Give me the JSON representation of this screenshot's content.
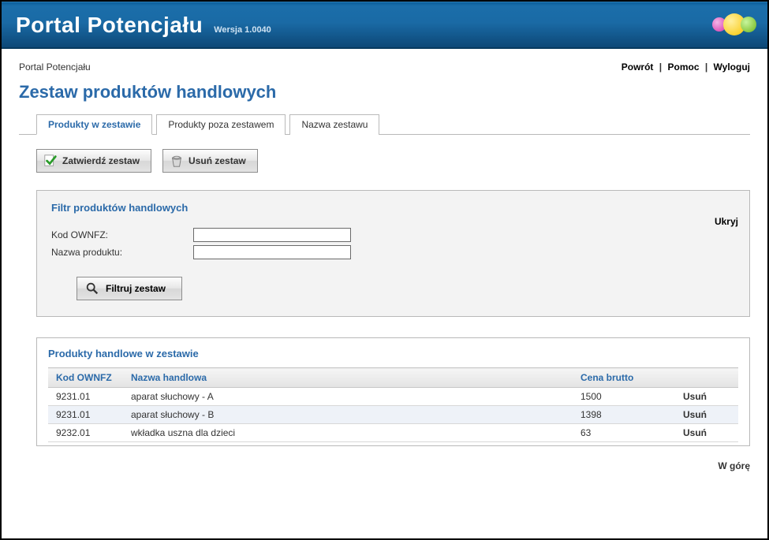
{
  "header": {
    "title": "Portal Potencjału",
    "version": "Wersja 1.0040"
  },
  "topbar": {
    "breadcrumb": "Portal Potencjału",
    "links": {
      "back": "Powrót",
      "help": "Pomoc",
      "logout": "Wyloguj"
    }
  },
  "page_title": "Zestaw produktów handlowych",
  "tabs": [
    {
      "label": "Produkty w zestawie",
      "active": true
    },
    {
      "label": "Produkty poza zestawem",
      "active": false
    },
    {
      "label": "Nazwa zestawu",
      "active": false
    }
  ],
  "buttons": {
    "approve": "Zatwierdź zestaw",
    "delete": "Usuń zestaw"
  },
  "filter": {
    "title": "Filtr produktów handlowych",
    "hide": "Ukryj",
    "kod_label": "Kod OWNFZ:",
    "nazwa_label": "Nazwa produktu:",
    "kod_value": "",
    "nazwa_value": "",
    "filter_btn": "Filtruj zestaw"
  },
  "table": {
    "title": "Produkty handlowe w zestawie",
    "headers": {
      "kod": "Kod OWNFZ",
      "nazwa": "Nazwa handlowa",
      "cena": "Cena brutto",
      "action": ""
    },
    "action_label": "Usuń",
    "rows": [
      {
        "kod": "9231.01",
        "nazwa": "aparat słuchowy - A",
        "cena": "1500"
      },
      {
        "kod": "9231.01",
        "nazwa": "aparat słuchowy - B",
        "cena": "1398"
      },
      {
        "kod": "9232.01",
        "nazwa": "wkładka uszna dla dzieci",
        "cena": "63"
      }
    ]
  },
  "footer": {
    "top": "W górę"
  }
}
